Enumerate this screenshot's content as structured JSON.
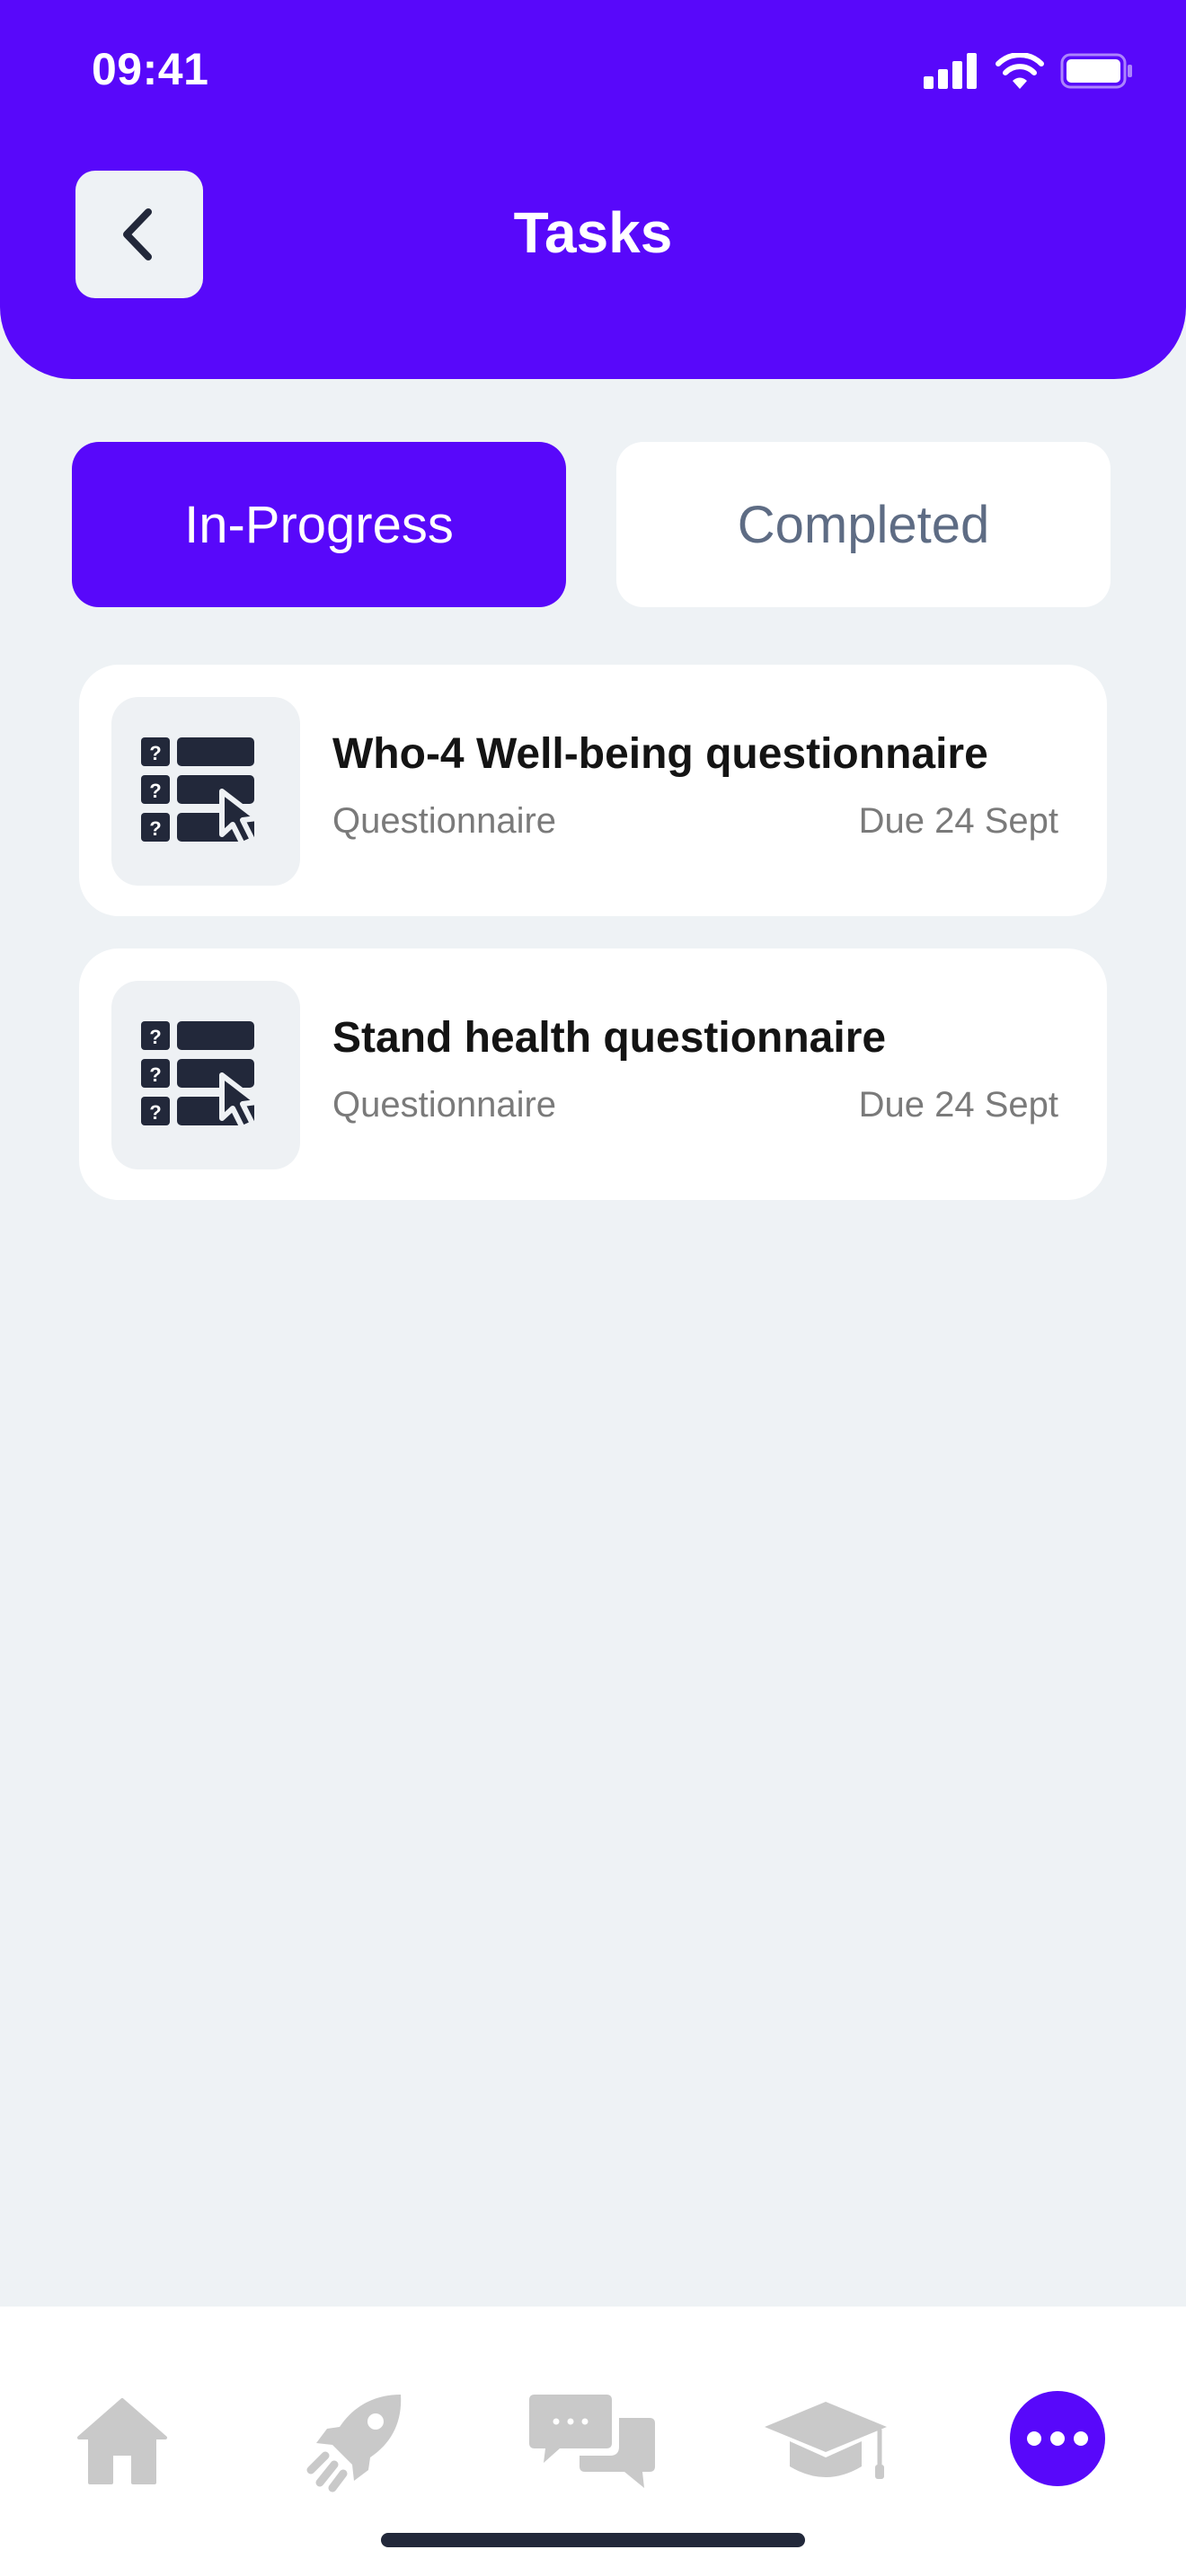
{
  "status_bar": {
    "time": "09:41"
  },
  "header": {
    "title": "Tasks"
  },
  "tabs": [
    {
      "label": "In-Progress",
      "active": true
    },
    {
      "label": "Completed",
      "active": false
    }
  ],
  "tasks": [
    {
      "title": "Who-4 Well-being questionnaire",
      "type": "Questionnaire",
      "due": "Due 24 Sept",
      "icon": "questionnaire-icon"
    },
    {
      "title": "Stand health questionnaire",
      "type": "Questionnaire",
      "due": "Due 24 Sept",
      "icon": "questionnaire-icon"
    }
  ],
  "bottom_nav": [
    {
      "icon": "home-icon",
      "active": false
    },
    {
      "icon": "rocket-icon",
      "active": false
    },
    {
      "icon": "chat-icon",
      "active": false
    },
    {
      "icon": "graduation-cap-icon",
      "active": false
    },
    {
      "icon": "more-icon",
      "active": true
    }
  ],
  "colors": {
    "accent": "#5808FA",
    "background": "#EEF2F5",
    "card": "#FFFFFF",
    "icon_dark": "#22283A",
    "nav_inactive": "#C9C9C9",
    "text_secondary": "#7A7A7A"
  }
}
